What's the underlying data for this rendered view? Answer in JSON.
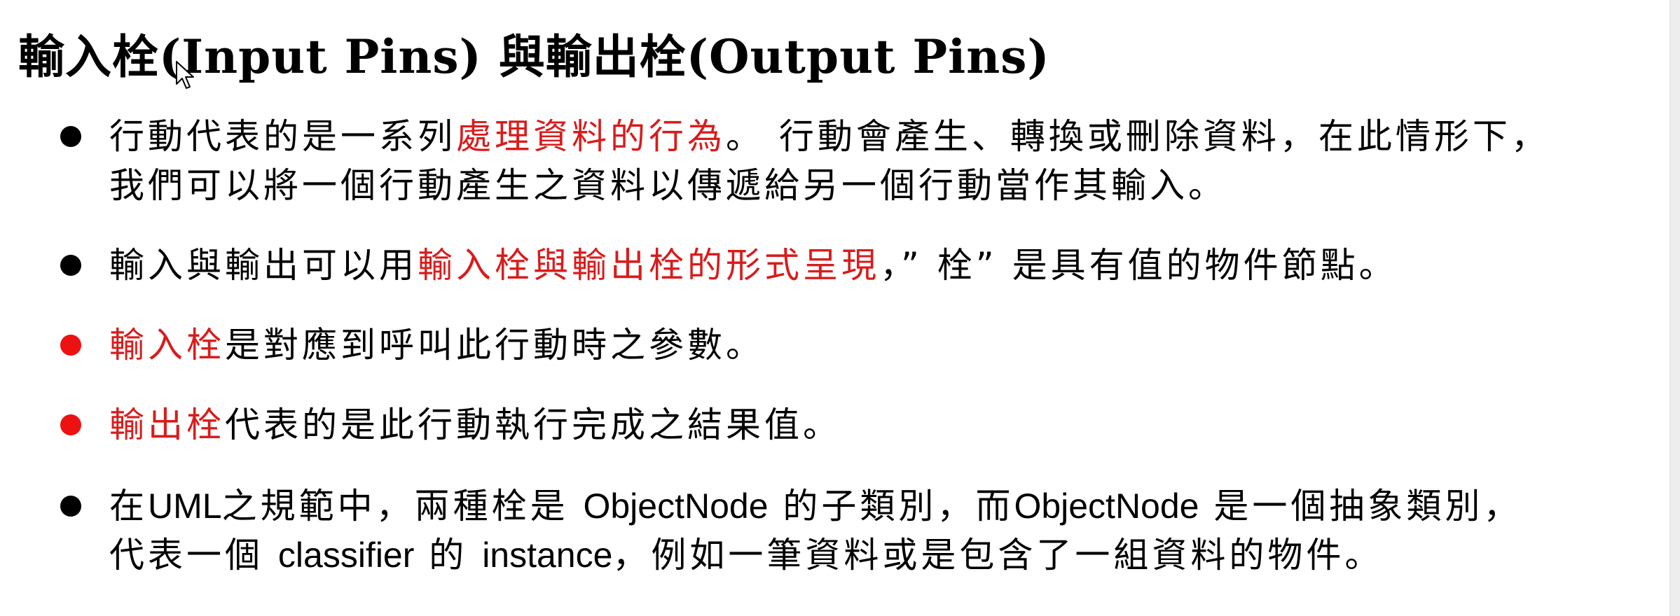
{
  "title": "輸入栓(Input Pins) 與輸出栓(Output Pins)",
  "colors": {
    "accent_red": "#d81c1c",
    "bullet_black": "#000000",
    "bullet_red": "#ee1111"
  },
  "bullets": [
    {
      "dot": "black",
      "line1_a": "行動代表的是一系列",
      "line1_highlight": "處理資料的行為",
      "line1_b": "。 行動會產生、轉換或刪除資料，在此情形下，",
      "line2": "我們可以將一個行動產生之資料以傳遞給另一個行動當作其輸入。"
    },
    {
      "dot": "black",
      "line1_a": "輸入與輸出可以用",
      "line1_highlight": "輸入栓與輸出栓的形式呈現",
      "line1_b": "，” 栓” 是具有值的物件節點。"
    },
    {
      "dot": "red",
      "line1_highlight": "輸入栓",
      "line1_b": "是對應到呼叫此行動時之參數。"
    },
    {
      "dot": "red",
      "line1_highlight": "輸出栓",
      "line1_b": "代表的是此行動執行完成之結果值。"
    },
    {
      "dot": "black",
      "line1_a": "在",
      "line1_uml": "UML",
      "line1_b": "之規範中，兩種栓是 ",
      "line1_obj1": "ObjectNode",
      "line1_c": " 的子類別，而",
      "line1_obj2": "ObjectNode",
      "line1_d": " 是一個抽象類別，",
      "line2_a": "代表一個 ",
      "line2_classifier": "classifier",
      "line2_b": " 的 ",
      "line2_instance": "instance",
      "line2_c": "，例如一筆資料或是包含了一組資料的物件。"
    }
  ]
}
